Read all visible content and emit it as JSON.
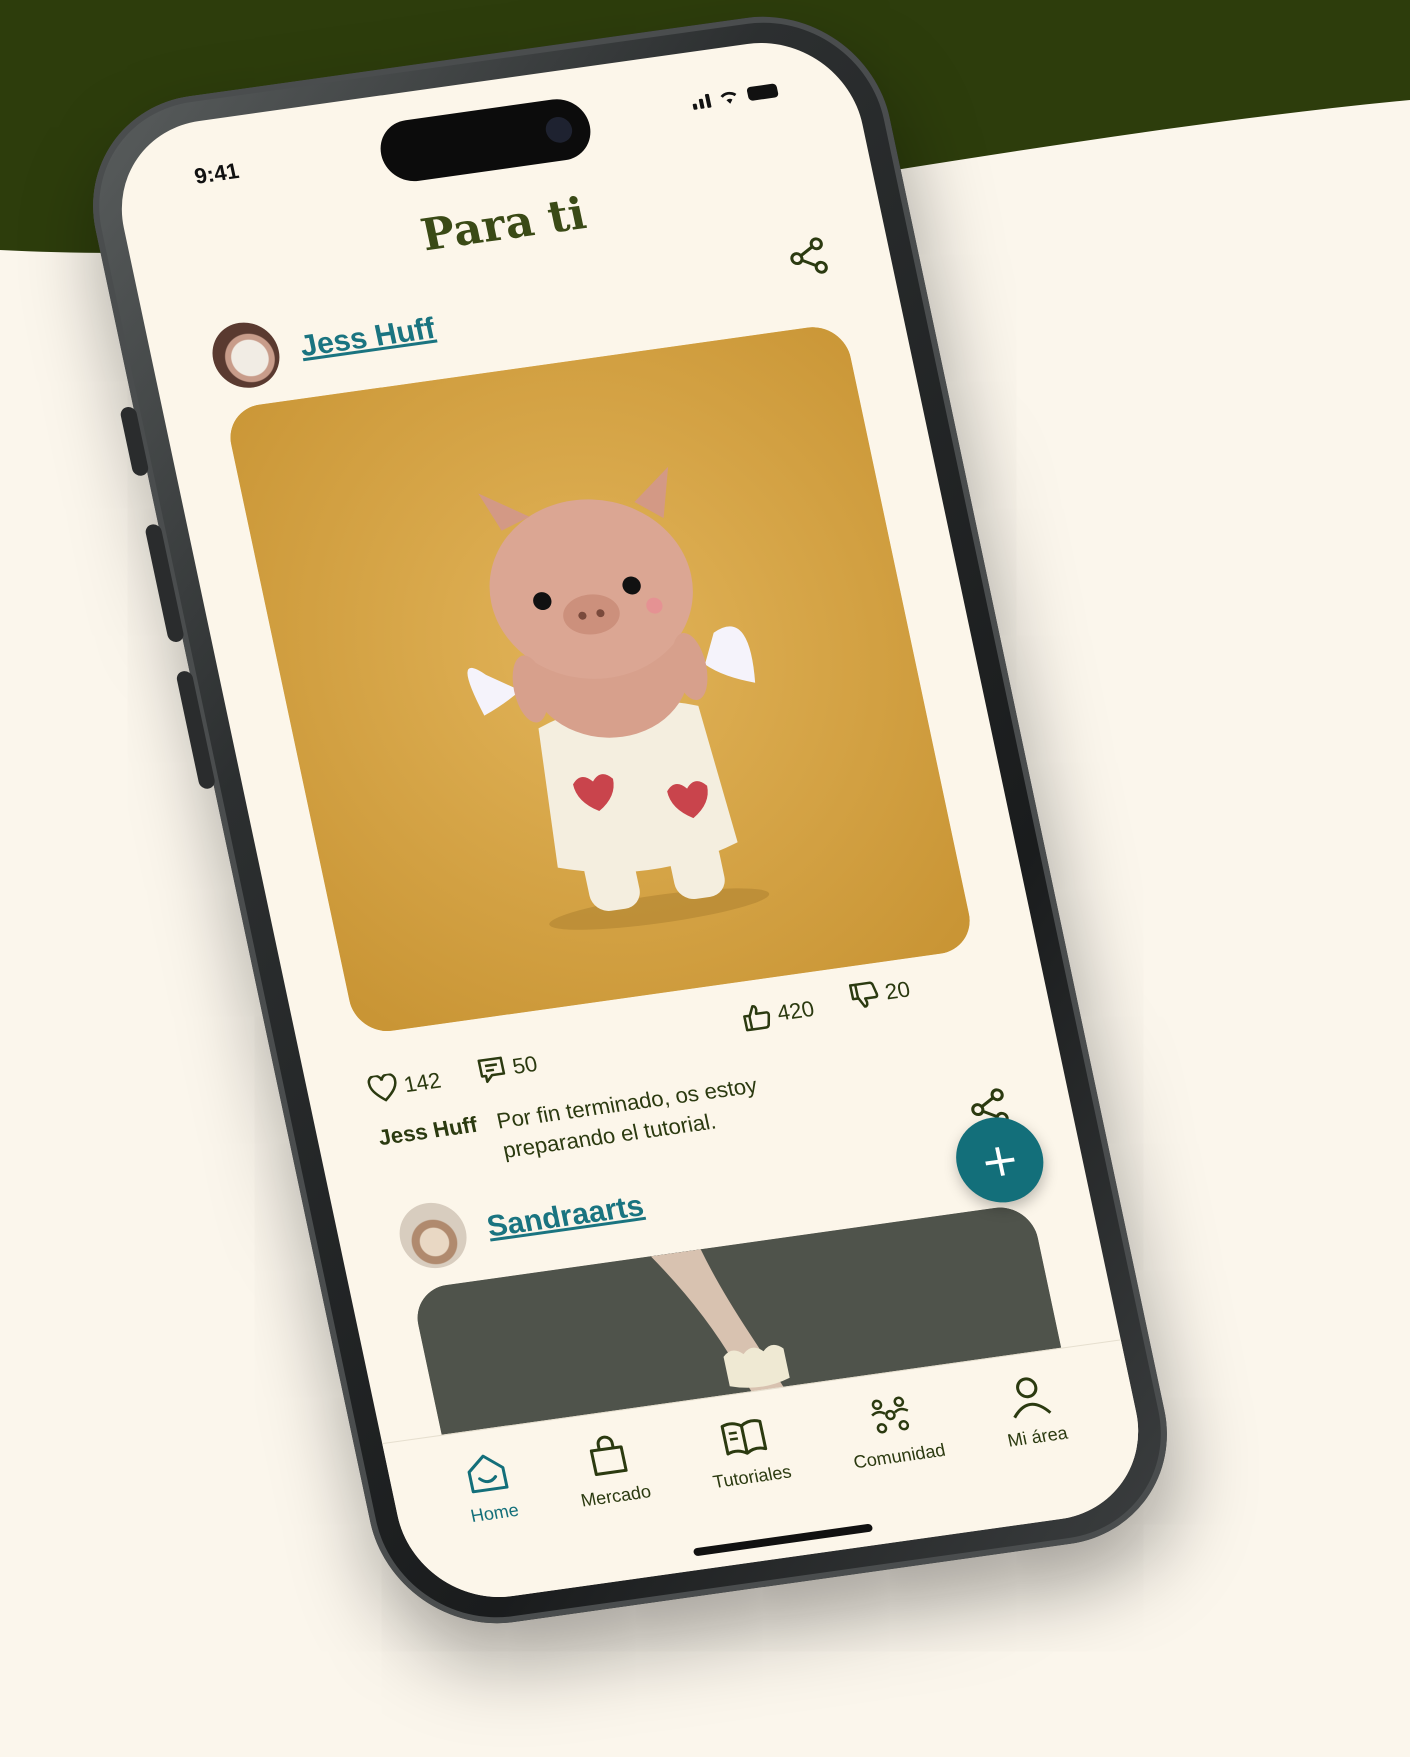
{
  "status_bar": {
    "time": "9:41"
  },
  "header": {
    "title": "Para ti"
  },
  "posts": [
    {
      "username": "Jess Huff",
      "likes": "142",
      "comments": "50",
      "thumbs_up": "420",
      "thumbs_down": "20",
      "caption_author": "Jess Huff",
      "caption_text": "Por fin terminado, os estoy preparando el tutorial."
    },
    {
      "username": "Sandraarts"
    }
  ],
  "fab": {
    "label": "+"
  },
  "nav": {
    "items": [
      {
        "label": "Home",
        "icon": "home-icon",
        "active": true
      },
      {
        "label": "Mercado",
        "icon": "bag-icon"
      },
      {
        "label": "Tutoriales",
        "icon": "book-icon"
      },
      {
        "label": "Comunidad",
        "icon": "community-icon"
      },
      {
        "label": "Mi área",
        "icon": "user-icon"
      }
    ]
  },
  "colors": {
    "brand_dark_green": "#2d3d0c",
    "accent_teal": "#136f7a",
    "background": "#fbf6ec",
    "photo_mustard": "#d6a64a"
  }
}
